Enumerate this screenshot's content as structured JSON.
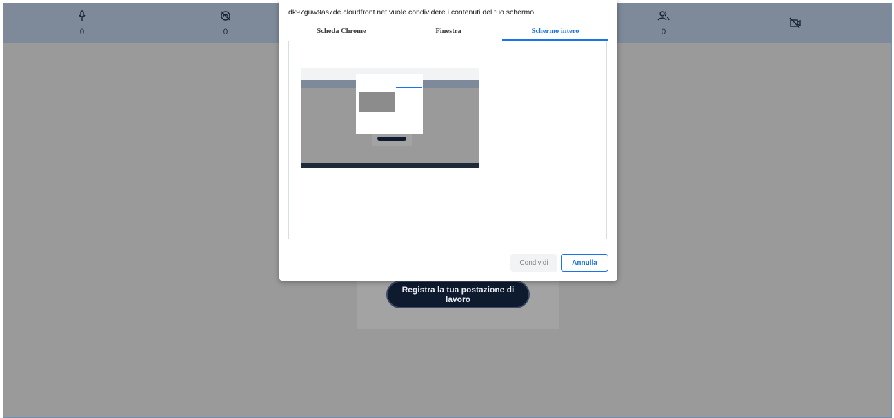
{
  "topbar": {
    "stats": [
      {
        "icon": "microphone-icon",
        "value": "0"
      },
      {
        "icon": "no-headphones-icon",
        "value": "0"
      },
      {
        "icon": "users-icon",
        "value": "0"
      },
      {
        "icon": "video-off-icon",
        "value": ""
      }
    ]
  },
  "main": {
    "register_button": "Registra la tua postazione di lavoro"
  },
  "dialog": {
    "title": "dk97guw9as7de.cloudfront.net vuole condividere i contenuti del tuo schermo.",
    "tabs": [
      "Scheda Chrome",
      "Finestra",
      "Schermo intero"
    ],
    "active_tab": "Schermo intero",
    "share_button": "Condividi",
    "cancel_button": "Annulla"
  },
  "colors": {
    "accent": "#1a73e8",
    "topbar": "#7e8a99",
    "background": "#9a9a9a",
    "register_button": "#0e1a2e"
  }
}
